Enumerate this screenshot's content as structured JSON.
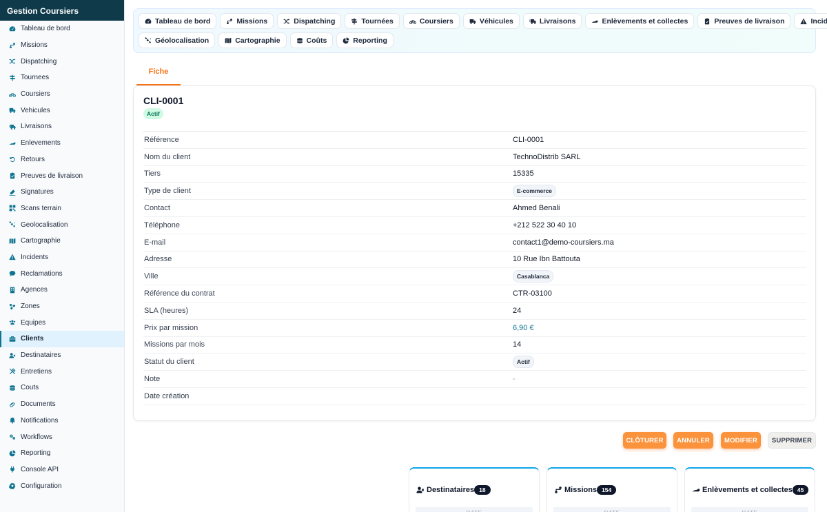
{
  "app": {
    "title": "Gestion Coursiers"
  },
  "sidebar": {
    "items": [
      {
        "label": "Tableau de bord",
        "icon": "dashboard-icon"
      },
      {
        "label": "Missions",
        "icon": "missions-icon"
      },
      {
        "label": "Dispatching",
        "icon": "shuffle-icon"
      },
      {
        "label": "Tournees",
        "icon": "signpost-icon"
      },
      {
        "label": "Coursiers",
        "icon": "bicycle-icon"
      },
      {
        "label": "Vehicules",
        "icon": "truck-icon"
      },
      {
        "label": "Livraisons",
        "icon": "truck-fast-icon"
      },
      {
        "label": "Enlevements",
        "icon": "pickup-icon"
      },
      {
        "label": "Retours",
        "icon": "return-icon"
      },
      {
        "label": "Preuves de livraison",
        "icon": "clipboard-check-icon"
      },
      {
        "label": "Signatures",
        "icon": "signature-icon"
      },
      {
        "label": "Scans terrain",
        "icon": "qrcode-icon"
      },
      {
        "label": "Geolocalisation",
        "icon": "satellite-icon"
      },
      {
        "label": "Cartographie",
        "icon": "map-icon"
      },
      {
        "label": "Incidents",
        "icon": "warning-icon"
      },
      {
        "label": "Reclamations",
        "icon": "comment-icon"
      },
      {
        "label": "Agences",
        "icon": "building-icon"
      },
      {
        "label": "Zones",
        "icon": "zones-icon"
      },
      {
        "label": "Equipes",
        "icon": "users-icon"
      },
      {
        "label": "Clients",
        "icon": "briefcase-icon",
        "active": true
      },
      {
        "label": "Destinataires",
        "icon": "user-tag-icon"
      },
      {
        "label": "Entretiens",
        "icon": "tools-icon"
      },
      {
        "label": "Couts",
        "icon": "coins-icon"
      },
      {
        "label": "Documents",
        "icon": "document-icon"
      },
      {
        "label": "Notifications",
        "icon": "bell-icon"
      },
      {
        "label": "Workflows",
        "icon": "gears-icon"
      },
      {
        "label": "Reporting",
        "icon": "pie-chart-icon"
      },
      {
        "label": "Console API",
        "icon": "plug-icon"
      },
      {
        "label": "Configuration",
        "icon": "gear-icon"
      }
    ]
  },
  "topnav": {
    "row1": [
      {
        "label": "Tableau de bord",
        "icon": "dashboard-icon"
      },
      {
        "label": "Missions",
        "icon": "missions-icon"
      },
      {
        "label": "Dispatching",
        "icon": "shuffle-icon"
      },
      {
        "label": "Tournées",
        "icon": "signpost-icon"
      },
      {
        "label": "Coursiers",
        "icon": "bicycle-icon"
      },
      {
        "label": "Véhicules",
        "icon": "truck-icon"
      },
      {
        "label": "Livraisons",
        "icon": "truck-fast-icon"
      },
      {
        "label": "Enlèvements et collectes",
        "icon": "pickup-icon"
      },
      {
        "label": "Preuves de livraison",
        "icon": "clipboard-check-icon"
      },
      {
        "label": "Incidents",
        "icon": "warning-icon"
      }
    ],
    "row2": [
      {
        "label": "Géolocalisation",
        "icon": "satellite-icon"
      },
      {
        "label": "Cartographie",
        "icon": "map-icon"
      },
      {
        "label": "Coûts",
        "icon": "coins-icon"
      },
      {
        "label": "Reporting",
        "icon": "pie-chart-icon"
      }
    ]
  },
  "tabs": {
    "fiche": "Fiche"
  },
  "record": {
    "title": "CLI-0001",
    "status_badge": "Actif",
    "fields": [
      {
        "label": "Référence",
        "value": "CLI-0001",
        "kind": "text"
      },
      {
        "label": "Nom du client",
        "value": "TechnoDistrib SARL",
        "kind": "text"
      },
      {
        "label": "Tiers",
        "value": "15335",
        "kind": "text"
      },
      {
        "label": "Type de client",
        "value": "E-commerce",
        "kind": "badge"
      },
      {
        "label": "Contact",
        "value": "Ahmed Benali",
        "kind": "text"
      },
      {
        "label": "Téléphone",
        "value": "+212 522 30 40 10",
        "kind": "text"
      },
      {
        "label": "E-mail",
        "value": "contact1@demo-coursiers.ma",
        "kind": "text"
      },
      {
        "label": "Adresse",
        "value": "10 Rue Ibn Battouta",
        "kind": "text"
      },
      {
        "label": "Ville",
        "value": "Casablanca",
        "kind": "badge"
      },
      {
        "label": "Référence du contrat",
        "value": "CTR-03100",
        "kind": "text"
      },
      {
        "label": "SLA (heures)",
        "value": "24",
        "kind": "text"
      },
      {
        "label": "Prix par mission",
        "value": "6,90 €",
        "kind": "link"
      },
      {
        "label": "Missions par mois",
        "value": "14",
        "kind": "text"
      },
      {
        "label": "Statut du client",
        "value": "Actif",
        "kind": "badge"
      },
      {
        "label": "Note",
        "value": "-",
        "kind": "muted"
      },
      {
        "label": "Date création",
        "value": "",
        "kind": "text"
      }
    ]
  },
  "actions": {
    "cloturer": "CLÔTURER",
    "annuler": "ANNULER",
    "modifier": "MODIFIER",
    "supprimer": "SUPPRIMER"
  },
  "panels": [
    {
      "title": "Destinataires",
      "count": "18",
      "column": "DATE",
      "icon": "user-tag-icon"
    },
    {
      "title": "Missions",
      "count": "154",
      "column": "DATE",
      "icon": "missions-icon"
    },
    {
      "title": "Enlèvements et collectes",
      "count": "45",
      "column": "DATE",
      "icon": "pickup-icon"
    }
  ],
  "colors": {
    "brand": "#0f3a4a",
    "accent": "#f97316",
    "link": "#0e7490"
  }
}
